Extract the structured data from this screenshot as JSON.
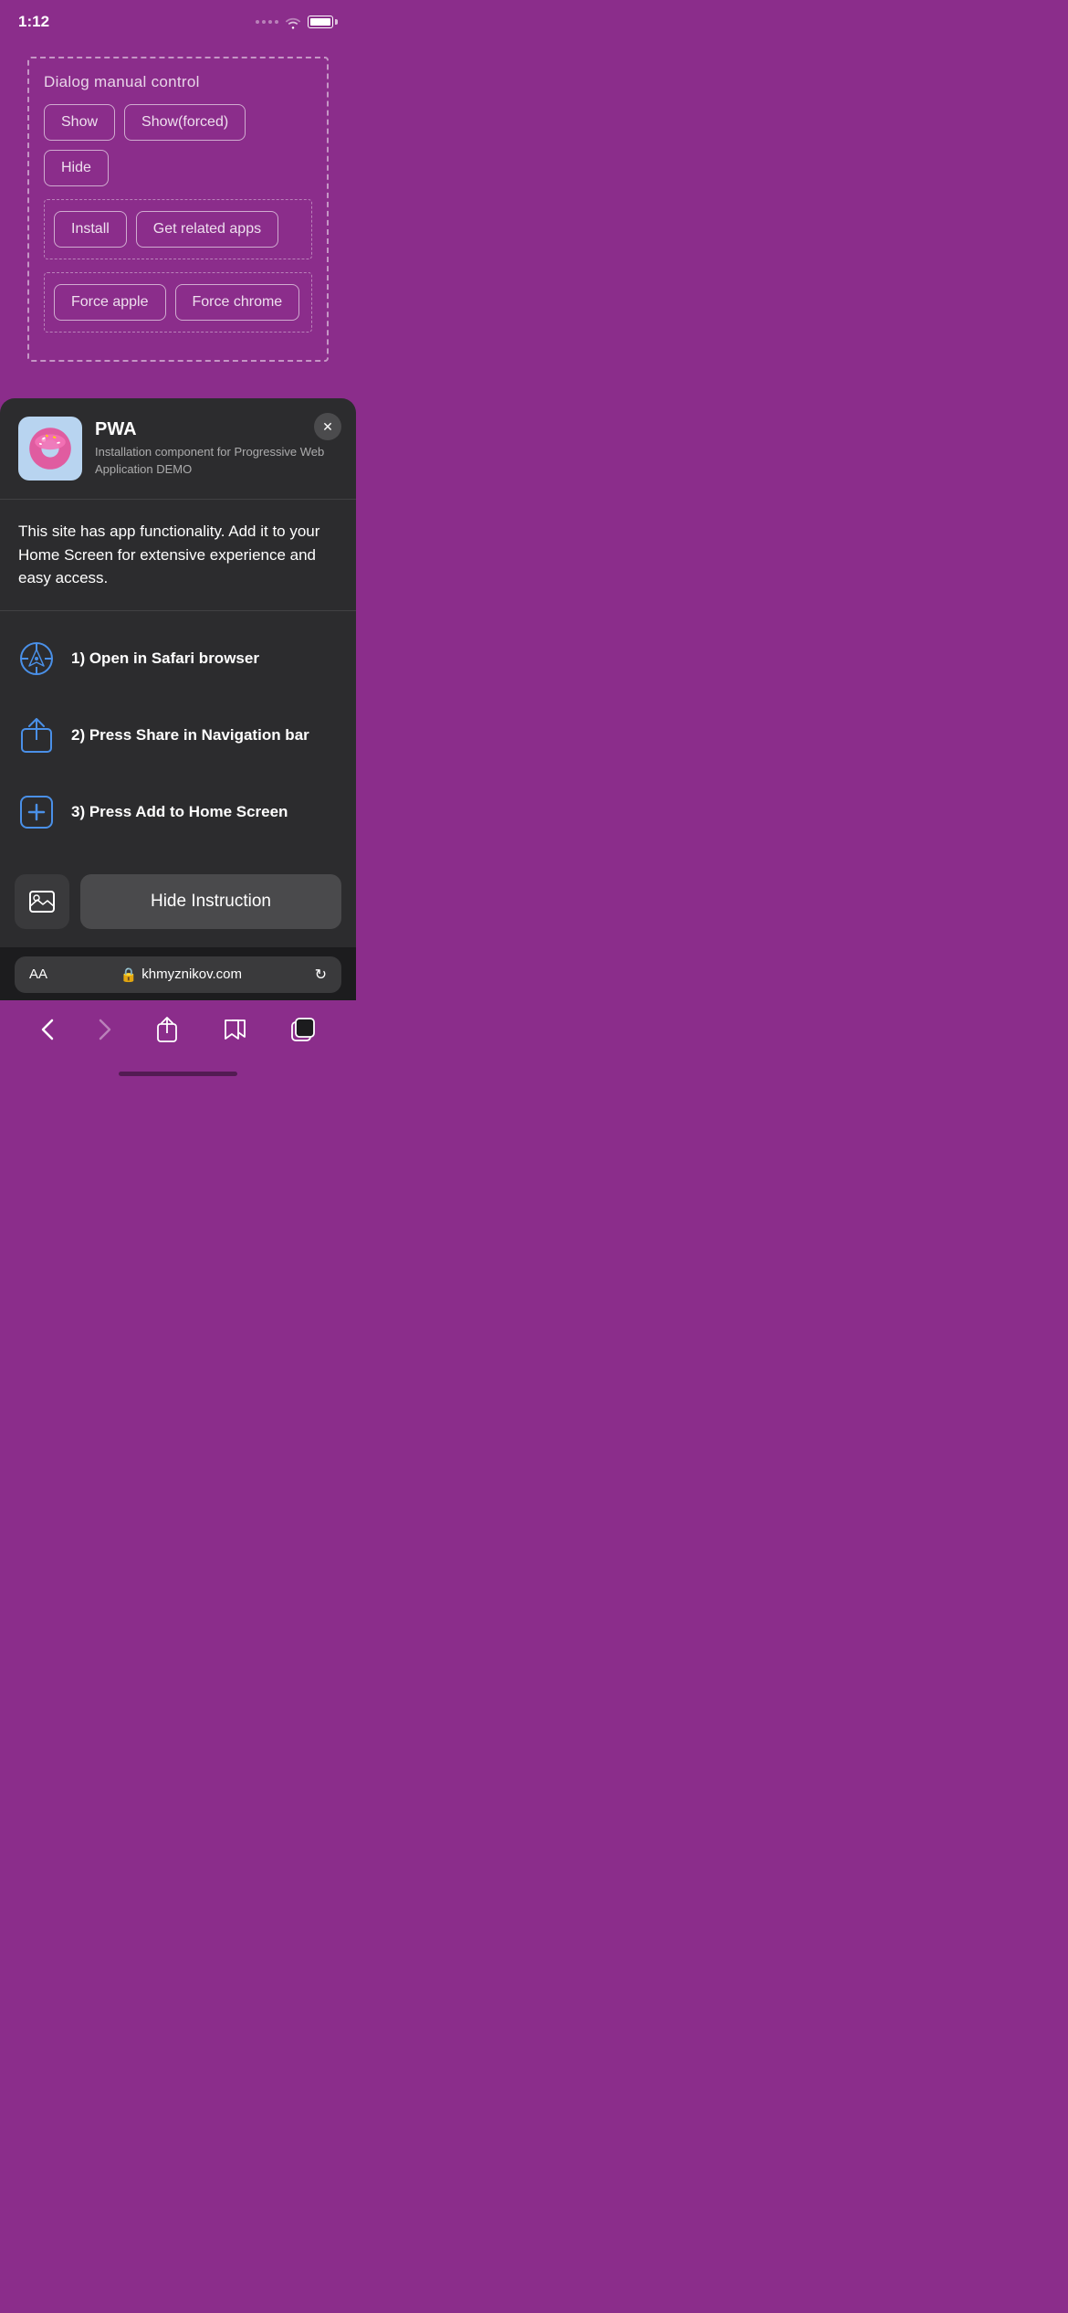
{
  "statusBar": {
    "time": "1:12"
  },
  "dialogControl": {
    "title": "Dialog manual control",
    "row1": {
      "show": "Show",
      "showForced": "Show(forced)",
      "hide": "Hide"
    },
    "row2": {
      "install": "Install",
      "getRelatedApps": "Get related apps"
    },
    "row3": {
      "forceApple": "Force apple",
      "forceChrome": "Force chrome"
    }
  },
  "pwaPanel": {
    "name": "PWA",
    "description": "Installation component for Progressive Web Application DEMO",
    "appDescription": "This site has app functionality. Add it to your Home Screen for extensive experience and easy access.",
    "instructions": [
      {
        "step": "1) Open in Safari browser"
      },
      {
        "step": "2) Press Share in Navigation bar"
      },
      {
        "step": "3) Press Add to Home Screen"
      }
    ],
    "hideInstruction": "Hide Instruction"
  },
  "browserBar": {
    "aa": "AA",
    "url": "khmyznikov.com",
    "lock": "🔒"
  },
  "nav": {
    "back": "‹",
    "forward": "›"
  }
}
